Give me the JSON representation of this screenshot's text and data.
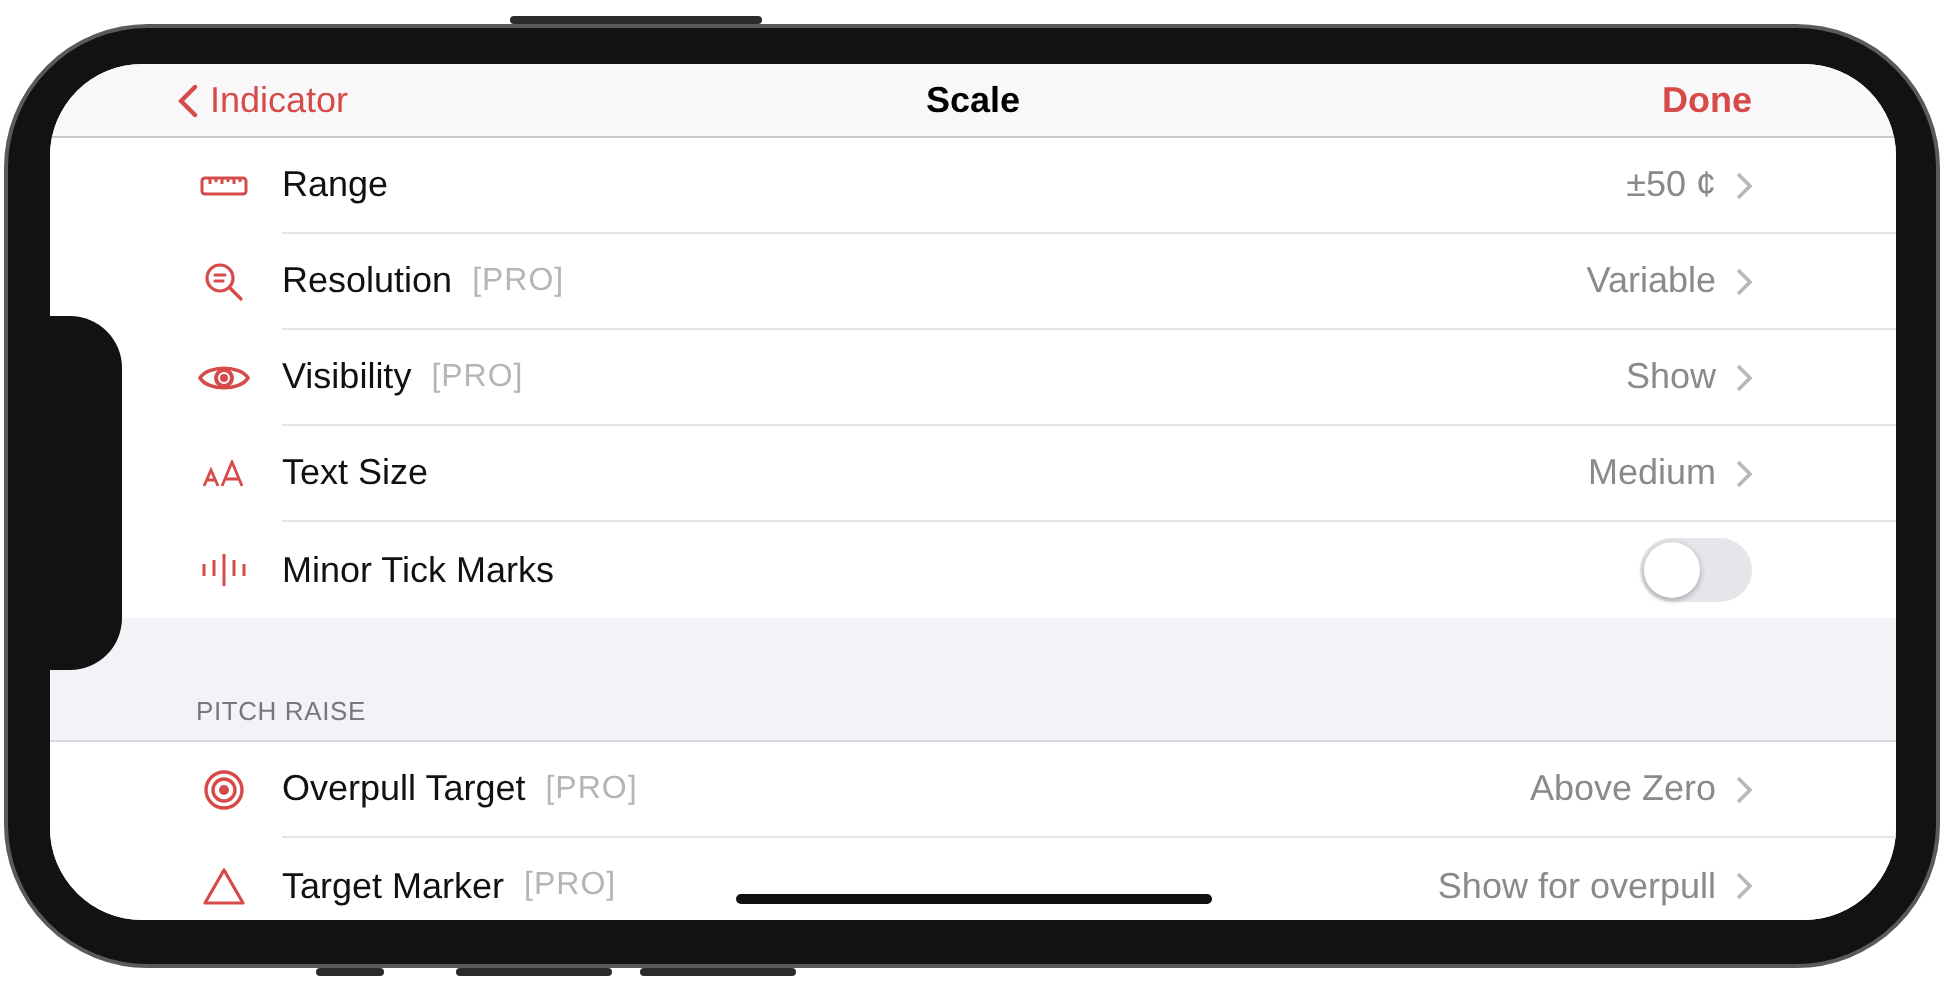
{
  "nav": {
    "back": "Indicator",
    "title": "Scale",
    "done": "Done"
  },
  "sections": [
    {
      "rows": [
        {
          "kind": "value",
          "label": "Range",
          "value": "±50 ¢"
        },
        {
          "kind": "value",
          "label": "Resolution",
          "badge": "[PRO]",
          "value": "Variable"
        },
        {
          "kind": "value",
          "label": "Visibility",
          "badge": "[PRO]",
          "value": "Show"
        },
        {
          "kind": "value",
          "label": "Text Size",
          "value": "Medium"
        },
        {
          "kind": "toggle",
          "label": "Minor Tick Marks",
          "on": false
        }
      ]
    },
    {
      "header": "PITCH RAISE",
      "rows": [
        {
          "kind": "value",
          "label": "Overpull Target",
          "badge": "[PRO]",
          "value": "Above Zero"
        },
        {
          "kind": "value",
          "label": "Target Marker",
          "badge": "[PRO]",
          "value": "Show for overpull"
        }
      ]
    }
  ]
}
